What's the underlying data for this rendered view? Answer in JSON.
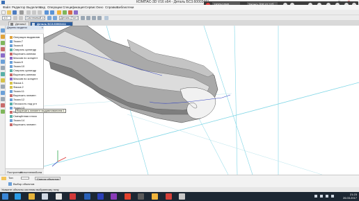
{
  "window": {
    "title": "КОМПАС-3D V16  x64 - Деталь БС3.60003411",
    "controls": [
      "—",
      "□",
      "✕"
    ]
  },
  "recorder": {
    "resolution": "1920x1080",
    "time": "Запись [00:41:17]"
  },
  "menu": [
    "Файл",
    "Редактор",
    "Выделить",
    "Вид",
    "Операции",
    "Спецификация",
    "Сервис",
    "Окно",
    "Справка",
    "Библиотеки"
  ],
  "toolbar": {
    "zoom": "1.0",
    "view_combo": "Системный слой",
    "orientation_combo": "Деталь (Тол О"
  },
  "tabs": [
    {
      "label": "Деталь2",
      "active": false
    },
    {
      "label": "Деталь БС3.60003411",
      "active": true
    }
  ],
  "tree": {
    "header": "Дерево модели",
    "items": [
      "Операция выдавлив",
      "Эскиз:7",
      "Эскиз:8",
      "Спираль цилиндр",
      "Вырезать кинема",
      "Массив по концент",
      "Эскиз:9",
      "Эскиз:10",
      "Спираль цилиндр",
      "Вырезать кинема",
      "Массив по концент",
      "Фаска:1",
      "Фаска:2",
      "Эскиз:11",
      "Вырезать элемен",
      "Эскиз:12",
      "Плоскость под угл",
      "Эскиз:13",
      "Вырезать элемен",
      "Смещённая плоск",
      "Эскиз:14",
      "Вырезать элемен"
    ],
    "tooltip": "Вырезать элемент выдавливанием:1",
    "bottom_tabs": [
      "Построение",
      "Исполнение",
      "Зона"
    ]
  },
  "properties": {
    "filter_label": "Тип",
    "object_list": "Список объектов",
    "select_objects": "Выбор объектов"
  },
  "status": {
    "text": "Укажите объекты системы выбранному типу"
  },
  "taskbar": {
    "time": "21:23",
    "date": "26.03.2017"
  },
  "colors": {
    "active_tab": "#2b5d9e",
    "taskbar": "#1c2733",
    "model_gray": "#a9a9a9",
    "axis_cyan": "#7fd6e6",
    "curve_blue": "#2f3fbf"
  }
}
